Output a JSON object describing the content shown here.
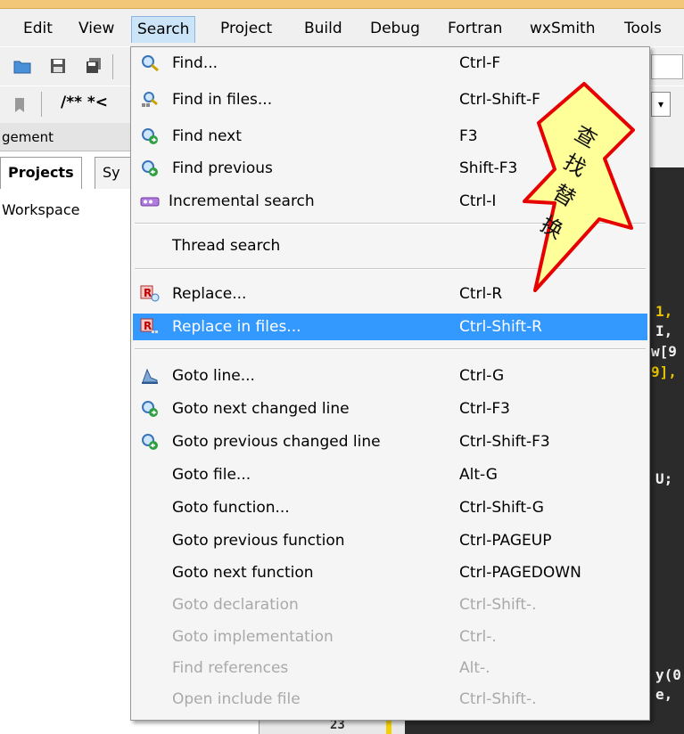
{
  "menubar": {
    "items": [
      {
        "label": "Edit"
      },
      {
        "label": "View"
      },
      {
        "label": "Search"
      },
      {
        "label": "Project"
      },
      {
        "label": "Build"
      },
      {
        "label": "Debug"
      },
      {
        "label": "Fortran"
      },
      {
        "label": "wxSmith"
      },
      {
        "label": "Tools"
      }
    ]
  },
  "toolbar": {
    "comment_label": "/** *<"
  },
  "side_panel": {
    "header": "gement",
    "tabs": [
      {
        "label": "Projects"
      },
      {
        "label": "Sy"
      }
    ],
    "tree_root": "Workspace"
  },
  "editor": {
    "fragments": [
      "1,",
      "I,",
      "w[9",
      "9],",
      "U;",
      "y(0",
      "e,",
      "23"
    ]
  },
  "search_menu": {
    "items": [
      {
        "label": "Find...",
        "shortcut": "Ctrl-F",
        "icon": "magnifier-icon",
        "enabled": true
      },
      {
        "label": "Find in files...",
        "shortcut": "Ctrl-Shift-F",
        "icon": "find-in-files-icon",
        "enabled": true
      },
      {
        "label": "Find next",
        "shortcut": "F3",
        "icon": "find-next-icon",
        "enabled": true
      },
      {
        "label": "Find previous",
        "shortcut": "Shift-F3",
        "icon": "find-previous-icon",
        "enabled": true
      },
      {
        "label": "Incremental search",
        "shortcut": "Ctrl-I",
        "icon": "incremental-search-icon",
        "enabled": true
      },
      {
        "label": "Thread search",
        "shortcut": "",
        "icon": "",
        "enabled": true
      },
      {
        "label": "Replace...",
        "shortcut": "Ctrl-R",
        "icon": "replace-icon",
        "enabled": true
      },
      {
        "label": "Replace in files...",
        "shortcut": "Ctrl-Shift-R",
        "icon": "replace-in-files-icon",
        "enabled": true,
        "highlighted": true
      },
      {
        "label": "Goto line...",
        "shortcut": "Ctrl-G",
        "icon": "goto-line-icon",
        "enabled": true
      },
      {
        "label": "Goto next changed line",
        "shortcut": "Ctrl-F3",
        "icon": "goto-next-changed-icon",
        "enabled": true
      },
      {
        "label": "Goto previous changed line",
        "shortcut": "Ctrl-Shift-F3",
        "icon": "goto-prev-changed-icon",
        "enabled": true
      },
      {
        "label": "Goto file...",
        "shortcut": "Alt-G",
        "icon": "",
        "enabled": true
      },
      {
        "label": "Goto function...",
        "shortcut": "Ctrl-Shift-G",
        "icon": "",
        "enabled": true
      },
      {
        "label": "Goto previous function",
        "shortcut": "Ctrl-PAGEUP",
        "icon": "",
        "enabled": true
      },
      {
        "label": "Goto next function",
        "shortcut": "Ctrl-PAGEDOWN",
        "icon": "",
        "enabled": true
      },
      {
        "label": "Goto declaration",
        "shortcut": "Ctrl-Shift-.",
        "icon": "",
        "enabled": false
      },
      {
        "label": "Goto implementation",
        "shortcut": "Ctrl-.",
        "icon": "",
        "enabled": false
      },
      {
        "label": "Find references",
        "shortcut": "Alt-.",
        "icon": "",
        "enabled": false
      },
      {
        "label": "Open include file",
        "shortcut": "Ctrl-Shift-.",
        "icon": "",
        "enabled": false
      }
    ]
  },
  "annotation": {
    "chars": [
      "查",
      "找",
      "替",
      "换"
    ],
    "fill_color": "#ffff99",
    "stroke_color": "#e60000"
  },
  "colors": {
    "highlight": "#3399ff",
    "menubar_active": "#cce4f7",
    "disabled_text": "#a9a9a9"
  }
}
